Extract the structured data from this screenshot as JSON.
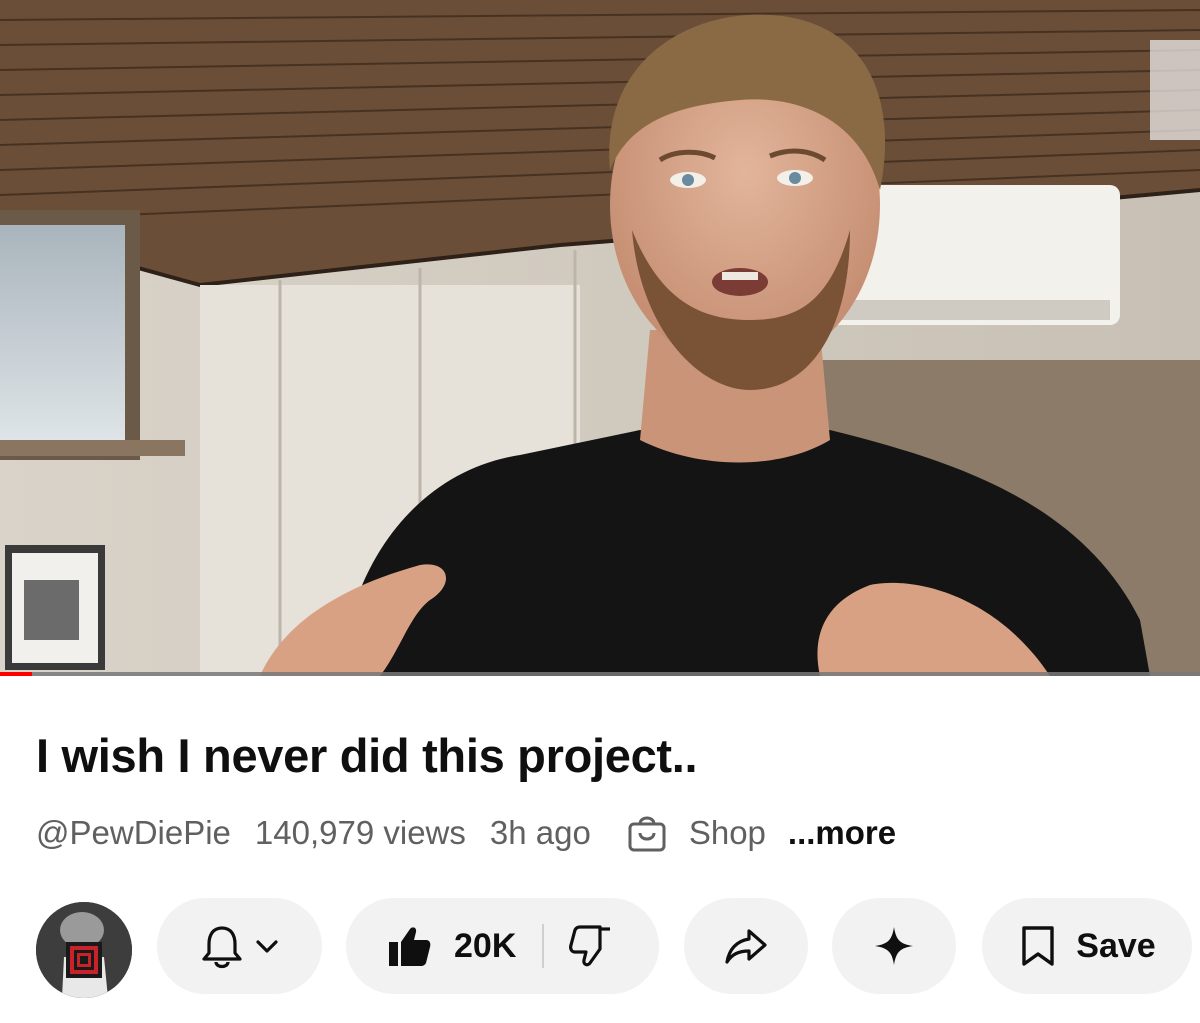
{
  "video": {
    "progress_fraction": 0.027,
    "progress_color": "#ff0000"
  },
  "info": {
    "title": "I wish I never did this project..",
    "channel_handle": "@PewDiePie",
    "views": "140,979 views",
    "age": "3h ago",
    "shop_label": "Shop",
    "more_label": "...more"
  },
  "actions": {
    "subscribe_icons": [
      "bell-icon",
      "chevron-down-icon"
    ],
    "like_icon": "thumbs-up-icon",
    "like_count": "20K",
    "dislike_icon": "thumbs-down-icon",
    "share_icon": "share-arrow-icon",
    "remix_icon": "sparkle-icon",
    "save_icon": "bookmark-icon",
    "save_label": "Save"
  },
  "colors": {
    "pill_background": "#f2f2f2",
    "text_primary": "#0f0f0f",
    "text_secondary": "#606060"
  }
}
